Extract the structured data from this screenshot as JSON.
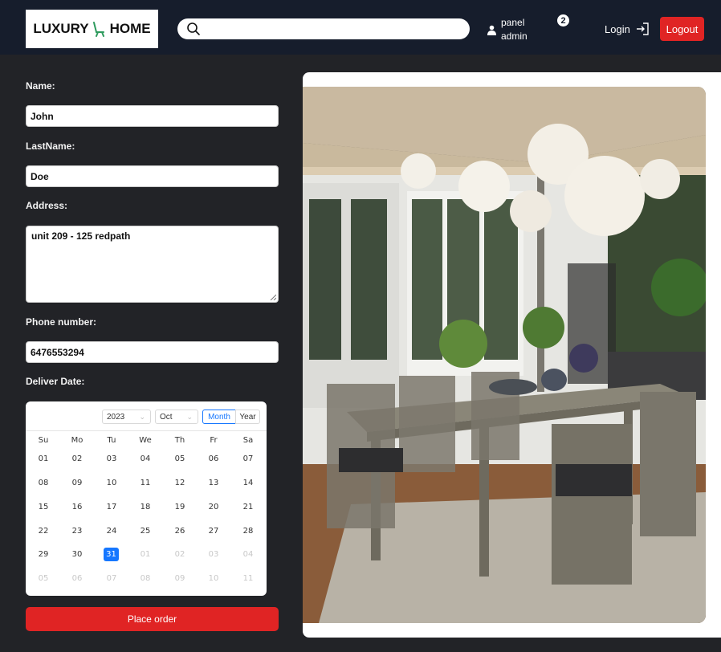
{
  "header": {
    "logo_left": "LUXURY",
    "logo_right": "HOME",
    "search_placeholder": "",
    "user_line1": "panel",
    "user_line2": "admin",
    "notification_count": "2",
    "login_label": "Login",
    "logout_label": "Logout"
  },
  "form": {
    "name_label": "Name:",
    "name_value": "John",
    "lastname_label": "LastName:",
    "lastname_value": "Doe",
    "address_label": "Address:",
    "address_value": "unit 209 - 125 redpath",
    "phone_label": "Phone number:",
    "phone_value": "6476553294",
    "date_label": "Deliver Date:",
    "order_button": "Place order"
  },
  "calendar": {
    "year": "2023",
    "month": "Oct",
    "mode_month": "Month",
    "mode_year": "Year",
    "weekdays": [
      "Su",
      "Mo",
      "Tu",
      "We",
      "Th",
      "Fr",
      "Sa"
    ],
    "days": [
      [
        "01",
        "02",
        "03",
        "04",
        "05",
        "06",
        "07"
      ],
      [
        "08",
        "09",
        "10",
        "11",
        "12",
        "13",
        "14"
      ],
      [
        "15",
        "16",
        "17",
        "18",
        "19",
        "20",
        "21"
      ],
      [
        "22",
        "23",
        "24",
        "25",
        "26",
        "27",
        "28"
      ],
      [
        "29",
        "30",
        "31",
        "01",
        "02",
        "03",
        "04"
      ],
      [
        "05",
        "06",
        "07",
        "08",
        "09",
        "10",
        "11"
      ]
    ],
    "selected_day": "31"
  },
  "colors": {
    "accent_red": "#e02424",
    "header_bg": "#161d2c",
    "page_bg": "#222327",
    "calendar_selected": "#1677ff"
  }
}
